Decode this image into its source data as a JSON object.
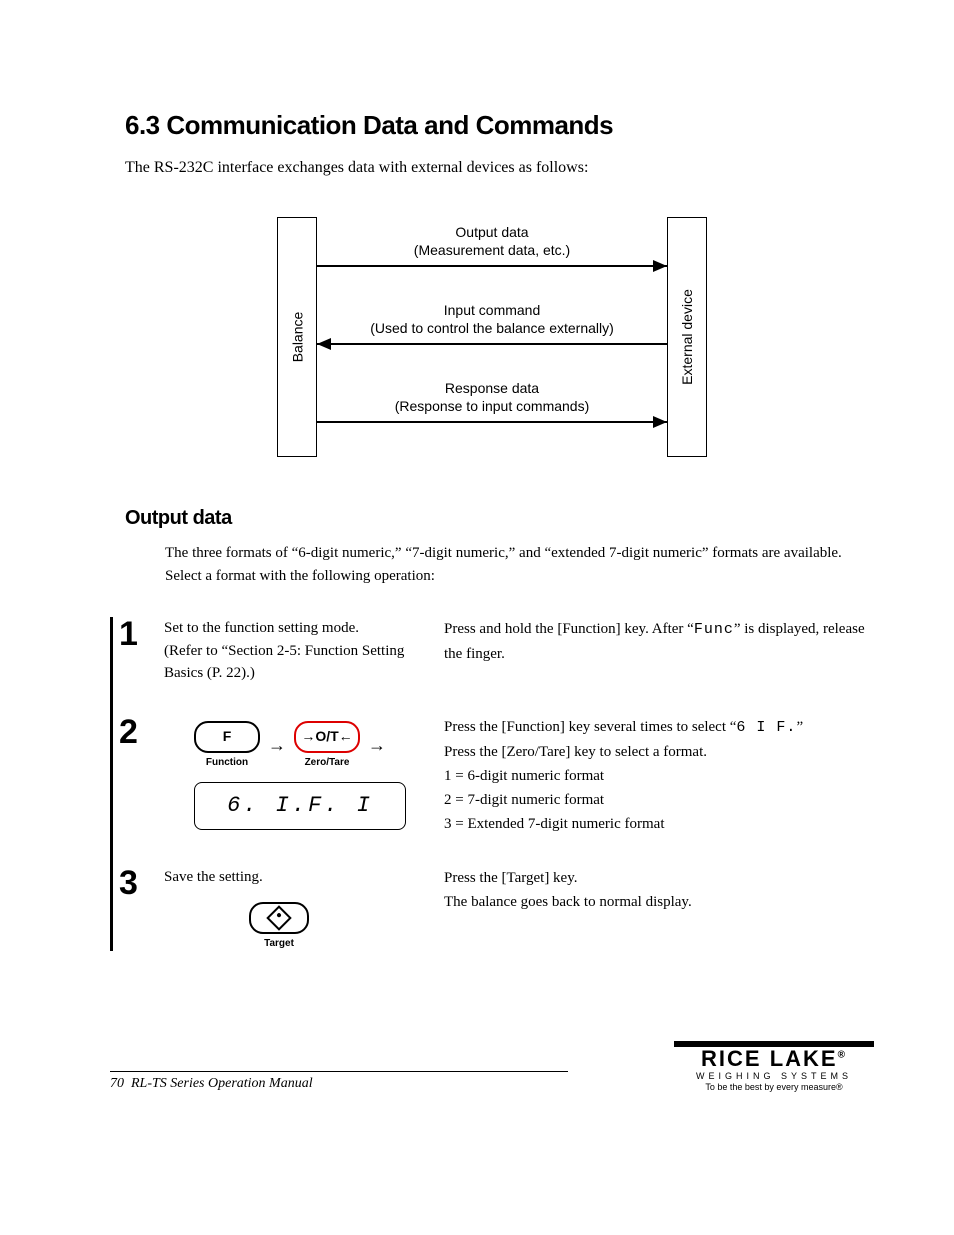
{
  "section_title": "6.3 Communication Data and Commands",
  "intro": "The RS-232C interface exchanges data with external devices as follows:",
  "diagram": {
    "left_label": "Balance",
    "right_label": "External device",
    "row1a": "Output data",
    "row1b": "(Measurement data, etc.)",
    "row2a": "Input command",
    "row2b": "(Used to control the balance externally)",
    "row3a": "Response data",
    "row3b": "(Response to input commands)"
  },
  "subsection_title": "Output data",
  "subsection_body": "The three formats of “6-digit numeric,” “7-digit numeric,” and “extended 7-digit numeric” formats are available. Select a format with the following operation:",
  "steps": {
    "s1_num": "1",
    "s1_left_a": "Set to the function setting mode.",
    "s1_left_b": "(Refer to “Section 2-5: Function Setting Basics (P. 22).)",
    "s1_right_a": "Press and hold the [Function] key. After “",
    "s1_right_seg": "Func",
    "s1_right_b": "” is displayed, release the finger.",
    "s2_num": "2",
    "s2_key_f": "F",
    "s2_key_f_lbl": "Function",
    "s2_key_zt": "→O/T←",
    "s2_key_zt_lbl": "Zero/Tare",
    "s2_lcd": "6. I.F. I",
    "s2_right_a": "Press the [Function] key several times to select “",
    "s2_right_seg": "6 I F.",
    "s2_right_b": "”",
    "s2_right_c": "Press the [Zero/Tare] key to select a format.",
    "s2_right_d": "1 = 6-digit numeric format",
    "s2_right_e": "2 = 7-digit numeric format",
    "s2_right_f": "3 = Extended 7-digit numeric format",
    "s3_num": "3",
    "s3_left": "Save the setting.",
    "s3_key_lbl": "Target",
    "s3_right_a": "Press the [Target] key.",
    "s3_right_b": "The balance goes back to normal display."
  },
  "footer": {
    "page": "70",
    "title": "RL-TS Series Operation Manual"
  },
  "logo": {
    "main": "RICE LAKE",
    "sub": "WEIGHING SYSTEMS",
    "tag": "To be the best by every measure®",
    "reg": "®"
  }
}
